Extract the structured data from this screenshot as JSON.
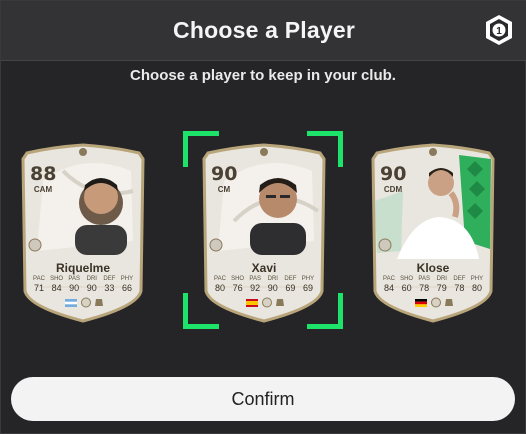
{
  "dialog": {
    "title": "Choose a Player",
    "subtitle": "Choose a player to keep in your club.",
    "counter_icon": "pack-count-icon",
    "counter_value": "1"
  },
  "cards": [
    {
      "rating": "88",
      "position": "CAM",
      "name": "Riquelme",
      "stats": [
        {
          "label": "PAC",
          "value": "71"
        },
        {
          "label": "SHO",
          "value": "84"
        },
        {
          "label": "PAS",
          "value": "90"
        },
        {
          "label": "DRI",
          "value": "90"
        },
        {
          "label": "DEF",
          "value": "33"
        },
        {
          "label": "PHY",
          "value": "66"
        }
      ],
      "flag": "argentina-flag-icon",
      "selected": false
    },
    {
      "rating": "90",
      "position": "CM",
      "name": "Xavi",
      "stats": [
        {
          "label": "PAC",
          "value": "80"
        },
        {
          "label": "SHO",
          "value": "76"
        },
        {
          "label": "PAS",
          "value": "92"
        },
        {
          "label": "DRI",
          "value": "90"
        },
        {
          "label": "DEF",
          "value": "69"
        },
        {
          "label": "PHY",
          "value": "69"
        }
      ],
      "flag": "spain-flag-icon",
      "selected": true
    },
    {
      "rating": "90",
      "position": "CDM",
      "name": "Klose",
      "stats": [
        {
          "label": "PAC",
          "value": "84"
        },
        {
          "label": "SHO",
          "value": "60"
        },
        {
          "label": "PAS",
          "value": "78"
        },
        {
          "label": "DRI",
          "value": "79"
        },
        {
          "label": "DEF",
          "value": "78"
        },
        {
          "label": "PHY",
          "value": "80"
        }
      ],
      "flag": "germany-flag-icon",
      "selected": false
    }
  ],
  "colors": {
    "selection": "#1ee36a",
    "card_base": "#e9e6df",
    "card_gold": "#b9a57a",
    "card_green_accent": "#2fae5b"
  },
  "confirm_label": "Confirm"
}
